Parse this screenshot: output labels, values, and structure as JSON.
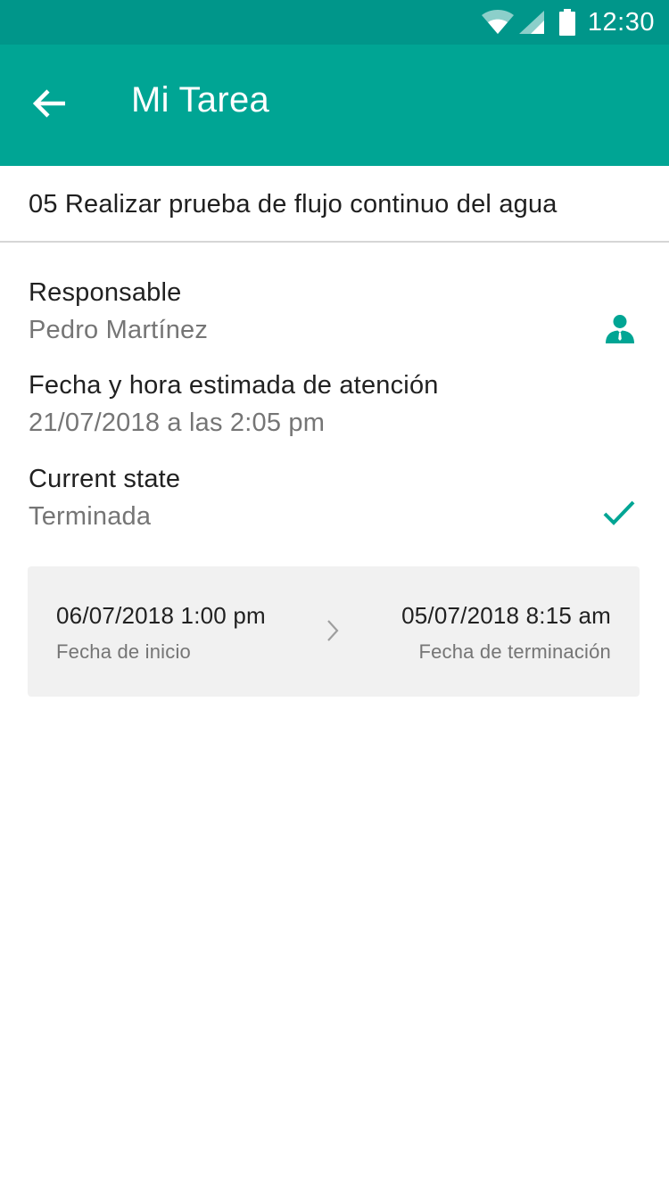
{
  "status_bar": {
    "time": "12:30",
    "icons": [
      "wifi-icon",
      "cell-signal-icon",
      "battery-icon"
    ]
  },
  "app_bar": {
    "title": "Mi Tarea",
    "back_icon": "arrow-back-icon"
  },
  "task": {
    "title": "05 Realizar prueba de flujo continuo del agua"
  },
  "responsible": {
    "label": "Responsable",
    "value": "Pedro Martínez",
    "icon": "person-icon"
  },
  "estimated_date": {
    "label": "Fecha y hora estimada de atención",
    "value": "21/07/2018 a las 2:05 pm"
  },
  "state": {
    "label": "Current state",
    "value": "Terminada",
    "icon": "check-icon"
  },
  "dates": {
    "start_value": "06/07/2018 1:00 pm",
    "start_label": "Fecha de inicio",
    "end_value": "05/07/2018 8:15 am",
    "end_label": "Fecha de terminación",
    "separator_icon": "chevron-right-icon"
  },
  "colors": {
    "status_bar": "#00968a",
    "app_bar": "#00a594",
    "accent": "#00a594",
    "card_background": "#f1f1f1"
  }
}
